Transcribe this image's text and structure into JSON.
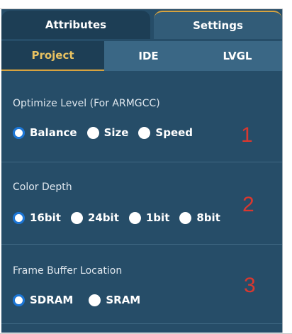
{
  "tabs": {
    "attributes": "Attributes",
    "settings": "Settings"
  },
  "subtabs": {
    "project": "Project",
    "ide": "IDE",
    "lvgl": "LVGL"
  },
  "sections": [
    {
      "label": "Optimize Level (For ARMGCC)",
      "options": [
        "Balance",
        "Size",
        "Speed"
      ],
      "selected": "Balance",
      "marker": "1"
    },
    {
      "label": "Color Depth",
      "options": [
        "16bit",
        "24bit",
        "1bit",
        "8bit"
      ],
      "selected": "16bit",
      "marker": "2"
    },
    {
      "label": "Frame Buffer Location",
      "options": [
        "SDRAM",
        "SRAM"
      ],
      "selected": "SDRAM",
      "marker": "3"
    }
  ],
  "colors": {
    "panel": "#264d68",
    "active_tab_text": "#e8c261",
    "radio_selected": "#1c76d6",
    "marker": "#d9382f"
  }
}
